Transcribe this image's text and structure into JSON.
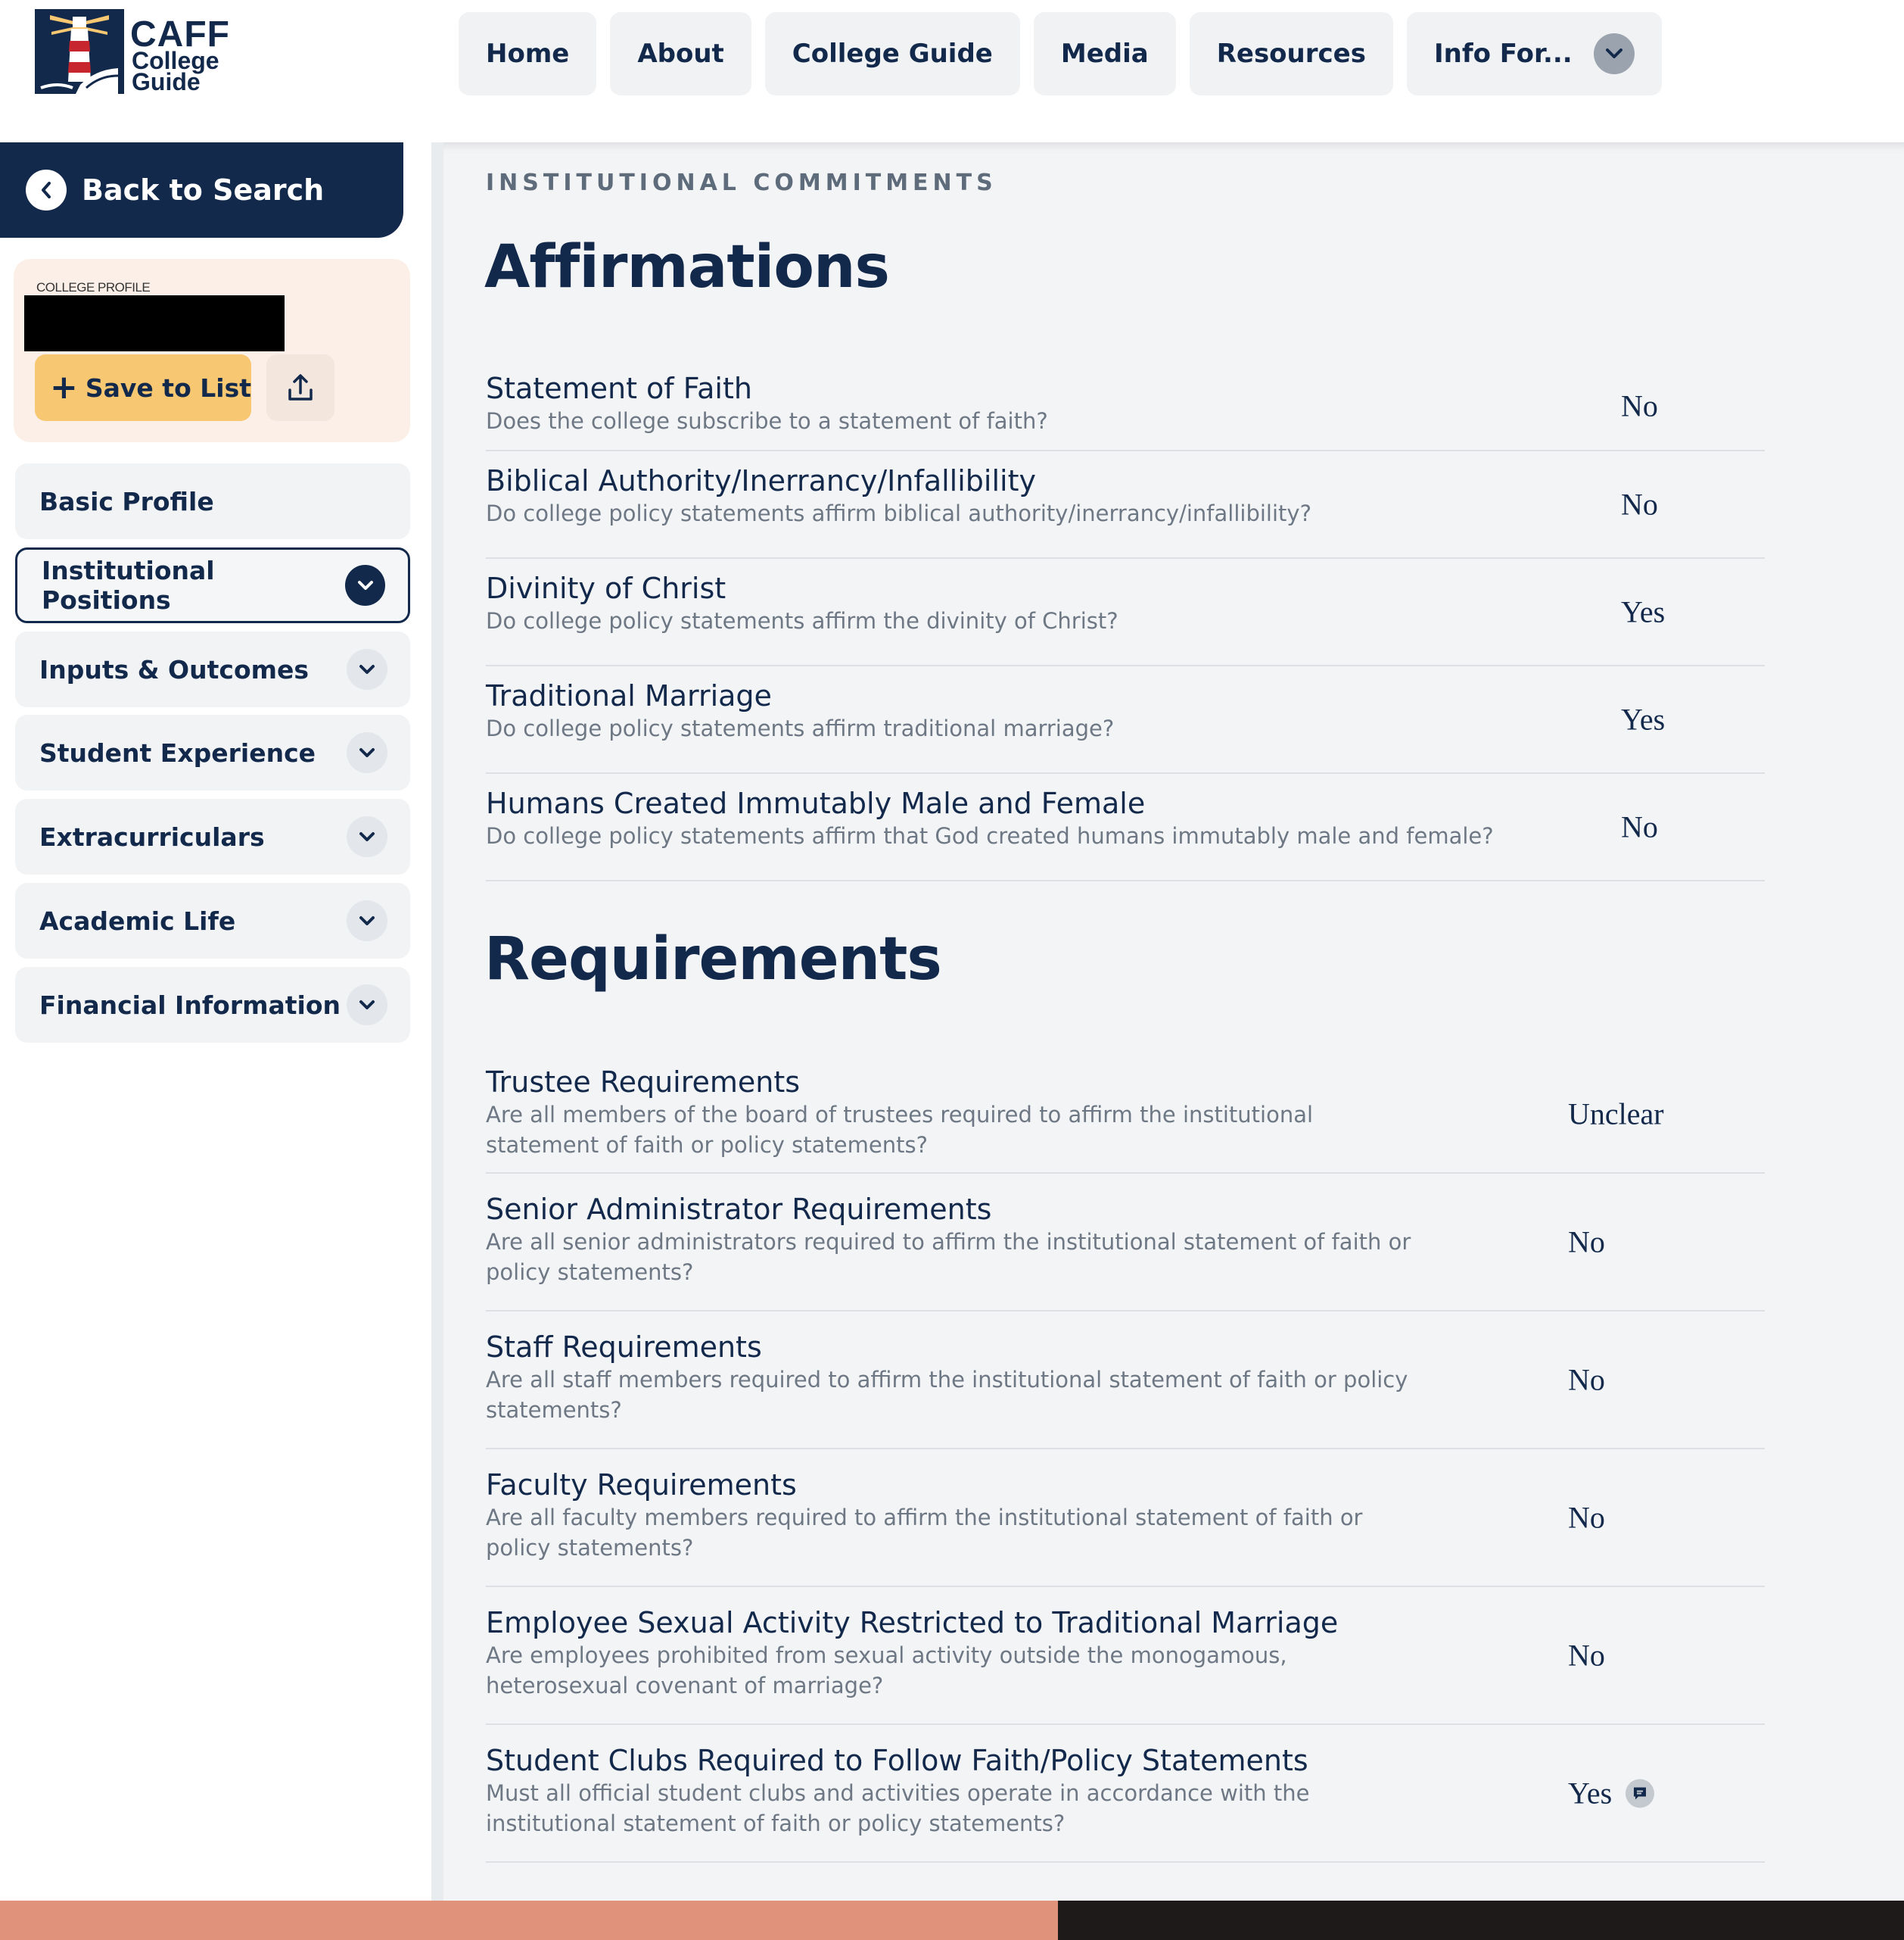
{
  "brand": {
    "name": "CAFF",
    "line1": "College",
    "line2": "Guide",
    "colors": {
      "navy": "#13294b",
      "gold": "#f8c771",
      "red": "#c8262e",
      "peach": "#fbefe7"
    }
  },
  "nav": {
    "items": [
      "Home",
      "About",
      "College Guide",
      "Media",
      "Resources",
      "Info For..."
    ]
  },
  "sidebar": {
    "back_label": "Back to Search",
    "profile_label": "COLLEGE PROFILE",
    "save_label": "Save to List",
    "items": [
      {
        "label": "Basic Profile",
        "has_chevron": false,
        "active": false
      },
      {
        "label": "Institutional Positions",
        "has_chevron": true,
        "active": true
      },
      {
        "label": "Inputs & Outcomes",
        "has_chevron": true,
        "active": false
      },
      {
        "label": "Student Experience",
        "has_chevron": true,
        "active": false
      },
      {
        "label": "Extracurriculars",
        "has_chevron": true,
        "active": false
      },
      {
        "label": "Academic Life",
        "has_chevron": true,
        "active": false
      },
      {
        "label": "Financial Information",
        "has_chevron": true,
        "active": false
      }
    ]
  },
  "main": {
    "eyebrow": "INSTITUTIONAL COMMITMENTS",
    "affirmations": {
      "heading": "Affirmations",
      "rows": [
        {
          "title": "Statement of Faith",
          "desc": "Does the college subscribe to a statement of faith?",
          "value": "No"
        },
        {
          "title": "Biblical Authority/Inerrancy/Infallibility",
          "desc": "Do college policy statements affirm biblical authority/inerrancy/infallibility?",
          "value": "No"
        },
        {
          "title": "Divinity of Christ",
          "desc": "Do college policy statements affirm the divinity of Christ?",
          "value": "Yes"
        },
        {
          "title": "Traditional Marriage",
          "desc": "Do college policy statements affirm traditional marriage?",
          "value": "Yes"
        },
        {
          "title": "Humans Created Immutably Male and Female",
          "desc": "Do college policy statements affirm that God created humans immutably male and female?",
          "value": "No"
        }
      ]
    },
    "requirements": {
      "heading": "Requirements",
      "rows": [
        {
          "title": "Trustee Requirements",
          "desc": "Are all members of the board of trustees required to affirm the institutional statement of faith or policy statements?",
          "value": "Unclear"
        },
        {
          "title": "Senior Administrator Requirements",
          "desc": "Are all senior administrators required to affirm the institutional statement of faith or policy statements?",
          "value": "No"
        },
        {
          "title": "Staff Requirements",
          "desc": "Are all staff members required to affirm the institutional statement of faith or policy statements?",
          "value": "No"
        },
        {
          "title": "Faculty Requirements",
          "desc": "Are all faculty members required to affirm the institutional statement of faith or policy statements?",
          "value": "No"
        },
        {
          "title": "Employee Sexual Activity Restricted to Traditional Marriage",
          "desc": "Are employees prohibited from sexual activity outside the monogamous, heterosexual covenant of marriage?",
          "value": "No"
        },
        {
          "title": "Student Clubs Required to Follow Faith/Policy Statements",
          "desc": "Must all official student clubs and activities operate in accordance with the institutional statement of faith or policy statements?",
          "value": "Yes",
          "has_comment": true
        }
      ]
    }
  }
}
